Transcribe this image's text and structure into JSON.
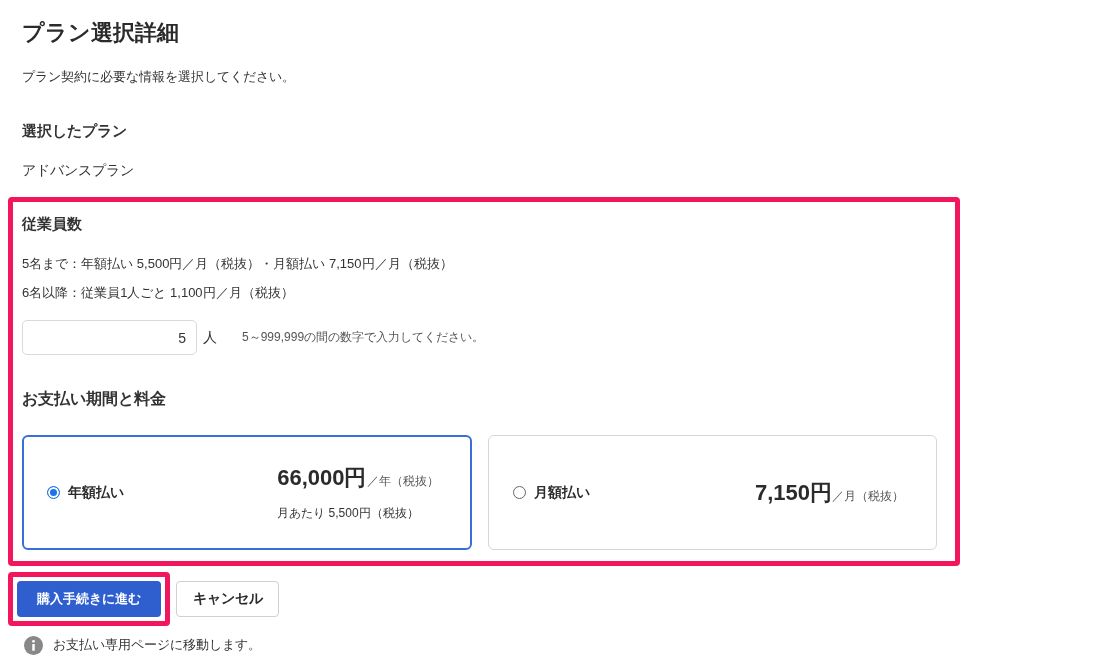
{
  "title": "プラン選択詳細",
  "description": "プラン契約に必要な情報を選択してください。",
  "selected_plan": {
    "heading": "選択したプラン",
    "value": "アドバンスプラン"
  },
  "plan_settings": {
    "highlighted": true,
    "employee_count": {
      "heading": "従業員数",
      "notes": [
        "5名まで：年額払い 5,500円／月（税抜）・月額払い 7,150円／月（税抜）",
        "6名以降：従業員1人ごと 1,100円／月（税抜）"
      ],
      "input": {
        "value": "5"
      },
      "unit": "人",
      "hint": "5～999,999の間の数字で入力してください。"
    },
    "payment": {
      "heading": "お支払い期間と料金",
      "options": [
        {
          "label": "年額払い",
          "selected": true,
          "price": "66,000円",
          "period": "／年（税抜）",
          "monthly": "月あたり 5,500円（税抜）"
        },
        {
          "label": "月額払い",
          "selected": false,
          "price": "7,150円",
          "period": "／月（税抜）"
        }
      ]
    }
  },
  "buttons": [
    {
      "label": "購入手続きに進む",
      "kind": "primary",
      "highlighted": true
    },
    {
      "label": "キャンセル",
      "kind": "secondary",
      "highlighted": false
    }
  ],
  "note": "お支払い専用ページに移動します。"
}
